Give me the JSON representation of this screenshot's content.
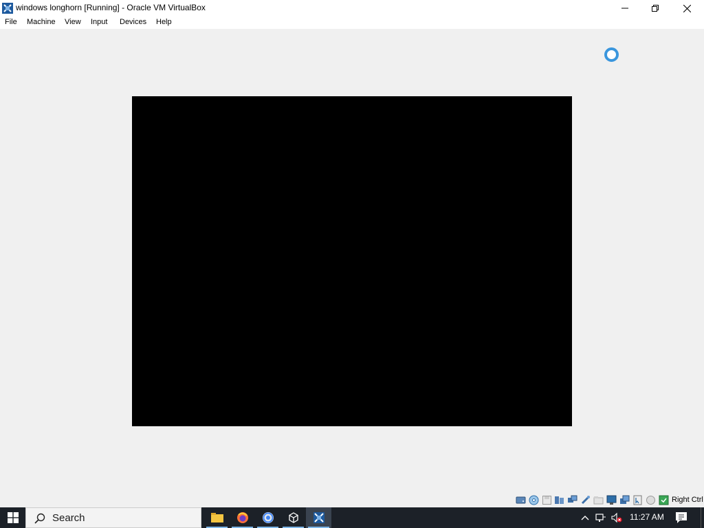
{
  "window": {
    "title": "windows longhorn [Running] - Oracle VM VirtualBox",
    "app_icon": "virtualbox-icon",
    "controls": [
      "minimize-icon",
      "restore-icon",
      "close-icon"
    ]
  },
  "menu": {
    "items": [
      "File",
      "Machine",
      "View",
      "Input",
      "Devices",
      "Help"
    ]
  },
  "vm": {
    "screen_color": "#000000",
    "cursor": "busy-cursor-icon"
  },
  "statusbar": {
    "icons": [
      "hard-disk-icon",
      "optical-drive-icon",
      "floppy-icon",
      "audio-icon",
      "network-icon",
      "usb-icon",
      "shared-folders-icon",
      "display-icon",
      "video-capture-icon",
      "mouse-integration-icon",
      "keyboard-icon",
      "cpu-icon",
      "arrow-icon"
    ],
    "host_key": "Right Ctrl"
  },
  "taskbar": {
    "search_placeholder": "Search",
    "apps": [
      "file-explorer-icon",
      "firefox-icon",
      "chrome-icon",
      "virtualbox-manager-icon",
      "virtualbox-vm-icon"
    ],
    "clock": "11:27 AM",
    "accent": "#7eb6e8"
  }
}
